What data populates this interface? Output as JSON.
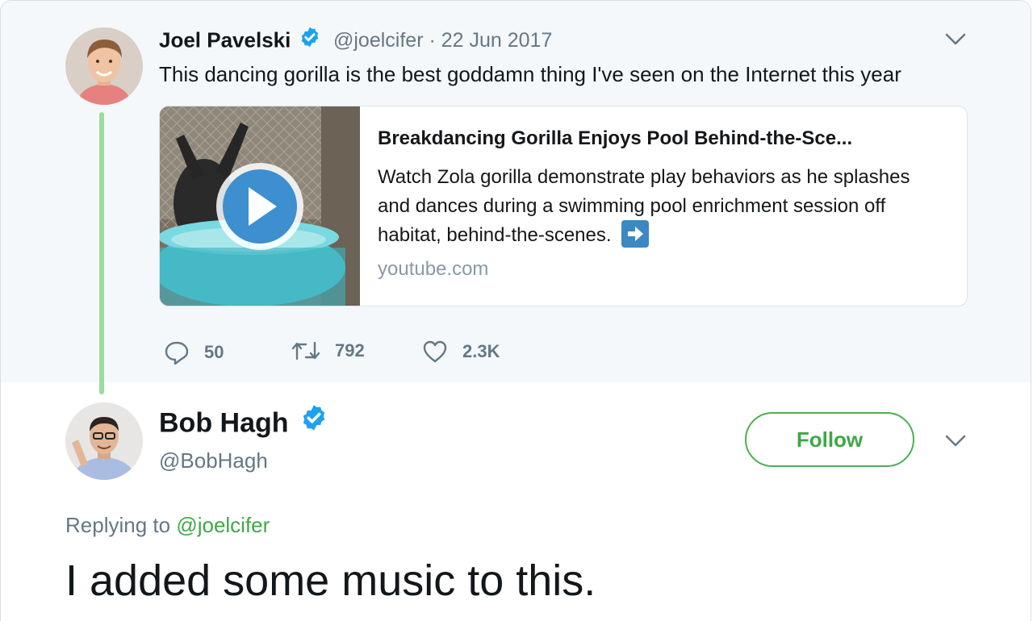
{
  "parent_tweet": {
    "author_name": "Joel Pavelski",
    "handle_date": "@joelcifer · 22 Jun 2017",
    "text": "This dancing gorilla is the best goddamn thing I've seen on the Internet this year",
    "card": {
      "title": "Breakdancing Gorilla Enjoys Pool Behind-the-Sce...",
      "description": "Watch Zola gorilla demonstrate play behaviors as he splashes and dances during a swimming pool enrichment session off habitat, behind-the-scenes.",
      "domain": "youtube.com"
    },
    "actions": {
      "replies": "50",
      "retweets": "792",
      "likes": "2.3K"
    }
  },
  "reply_tweet": {
    "author_name": "Bob Hagh",
    "handle": "@BobHagh",
    "follow_label": "Follow",
    "replying_prefix": "Replying to",
    "replying_handle": "@joelcifer",
    "text": "I added some music to this."
  },
  "colors": {
    "accent_green": "#3fa845",
    "verified_blue": "#1da1f2",
    "muted": "#657786",
    "thread_line": "#9bdc9f"
  },
  "icons": [
    "verified-icon",
    "chevron-down-icon",
    "play-icon",
    "reply-icon",
    "retweet-icon",
    "like-icon",
    "arrow-right-icon"
  ]
}
